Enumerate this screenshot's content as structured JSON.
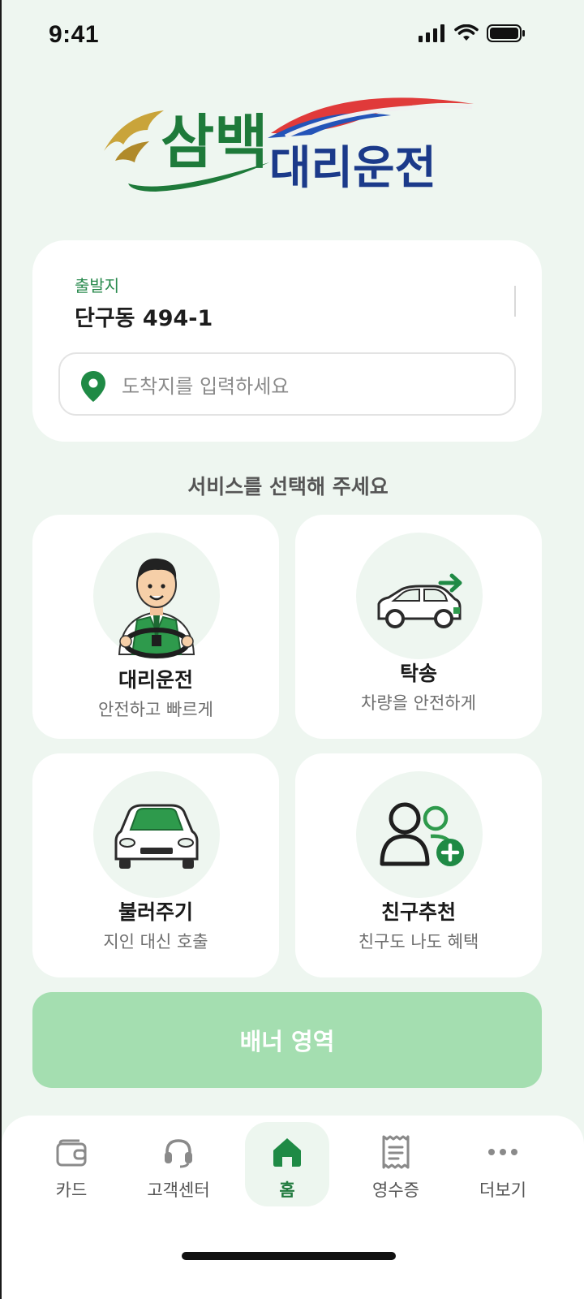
{
  "status_bar": {
    "time": "9:41"
  },
  "logo": {
    "text_main": "삼백",
    "text_sub": "대리운전"
  },
  "address": {
    "origin_label": "출발지",
    "origin_value": "단구동 494-1",
    "destination_placeholder": "도착지를 입력하세요"
  },
  "services": {
    "section_title": "서비스를 선택해 주세요",
    "items": [
      {
        "title": "대리운전",
        "subtitle": "안전하고 빠르게",
        "icon": "driver-icon"
      },
      {
        "title": "탁송",
        "subtitle": "차량을 안전하게",
        "icon": "car-transfer-icon"
      },
      {
        "title": "불러주기",
        "subtitle": "지인 대신 호출",
        "icon": "car-front-icon"
      },
      {
        "title": "친구추천",
        "subtitle": "친구도 나도 혜택",
        "icon": "add-friend-icon"
      }
    ]
  },
  "banner": {
    "label": "배너 영역"
  },
  "bottom_nav": {
    "items": [
      {
        "label": "카드",
        "icon": "wallet-icon"
      },
      {
        "label": "고객센터",
        "icon": "headset-icon"
      },
      {
        "label": "홈",
        "icon": "home-icon",
        "active": true
      },
      {
        "label": "영수증",
        "icon": "receipt-icon"
      },
      {
        "label": "더보기",
        "icon": "more-icon"
      }
    ]
  },
  "colors": {
    "accent": "#1f8a45",
    "background": "#eef6f0",
    "banner": "#a4deb0",
    "logo_green": "#1e7a3a",
    "logo_navy": "#1b3a8a",
    "logo_red": "#e03a3a"
  }
}
